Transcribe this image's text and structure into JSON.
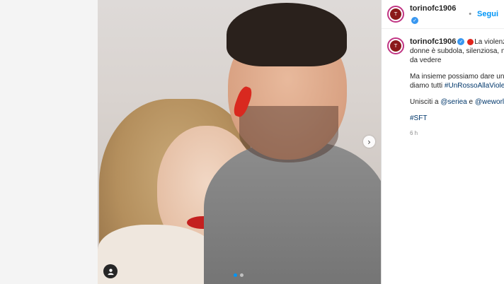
{
  "post": {
    "username": "torinofc1906",
    "follow_label": "Segui",
    "separator": "•",
    "verified_icon": "✓",
    "avatar_text": "T",
    "next_icon": "›",
    "caption": {
      "line1_text": "La violenza",
      "line2": "donne è subdola, silenziosa, no",
      "line3": "da vedere",
      "para2_line1": "Ma insieme possiamo dare un",
      "para2_line2_text": "diamo tutti",
      "hashtag1": "#UnRossoAllaViole",
      "para3_text": "Unisciti a",
      "mention1": "@seriea",
      "para3_and": "e",
      "mention2": "@weworld",
      "hashtag2": "#SFT"
    },
    "time_ago": "6 h",
    "carousel": {
      "slide_count": 2,
      "active_index": 0
    }
  },
  "colors": {
    "accent": "#0095f6",
    "verified": "#3897f0",
    "brand_red": "#8b1a1a"
  }
}
